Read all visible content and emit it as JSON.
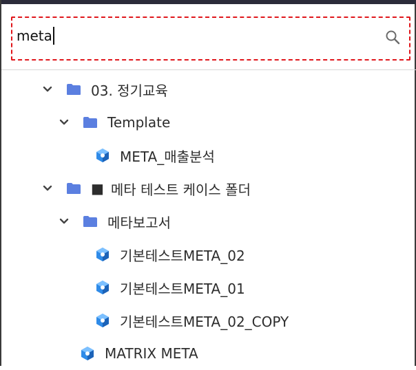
{
  "search": {
    "value": "meta",
    "icon": "search-icon",
    "highlight_color": "#e0151a"
  },
  "tree": {
    "items": [
      {
        "label": "03. 정기교육",
        "kind": "folder",
        "expanded": true,
        "level": 1
      },
      {
        "label": "Template",
        "kind": "folder",
        "expanded": true,
        "level": 2
      },
      {
        "label": "META_매출분석",
        "kind": "report",
        "level": 3
      },
      {
        "label": "메타 테스트 케이스 폴더",
        "kind": "folder",
        "expanded": true,
        "level": 1,
        "prefix": "■"
      },
      {
        "label": "메타보고서",
        "kind": "folder",
        "expanded": true,
        "level": 2
      },
      {
        "label": "기본테스트META_02",
        "kind": "report",
        "level": 3
      },
      {
        "label": "기본테스트META_01",
        "kind": "report",
        "level": 3
      },
      {
        "label": "기본테스트META_02_COPY",
        "kind": "report",
        "level": 3
      },
      {
        "label": "MATRIX META",
        "kind": "report",
        "level": 2
      }
    ]
  },
  "colors": {
    "folder": "#5b7fe0",
    "report_cube": "#2f8be8",
    "frame": "#3a3a3a"
  }
}
